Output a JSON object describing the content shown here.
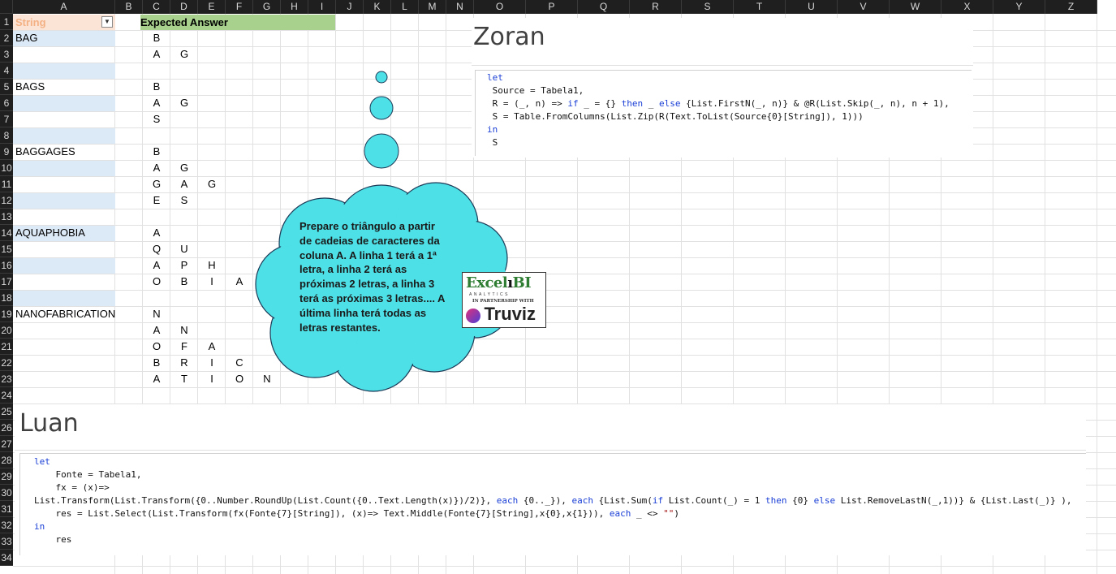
{
  "columns": [
    "A",
    "B",
    "C",
    "D",
    "E",
    "F",
    "G",
    "H",
    "I",
    "J",
    "K",
    "L",
    "M",
    "N",
    "O",
    "P",
    "Q",
    "R",
    "S",
    "T",
    "U",
    "V",
    "W",
    "X",
    "Y",
    "Z"
  ],
  "rows": [
    "1",
    "2",
    "3",
    "4",
    "5",
    "6",
    "7",
    "8",
    "9",
    "10",
    "11",
    "12",
    "13",
    "14",
    "15",
    "16",
    "17",
    "18",
    "19",
    "20",
    "21",
    "22",
    "23",
    "24",
    "25",
    "26",
    "27",
    "28",
    "29",
    "30",
    "31",
    "32",
    "33",
    "34"
  ],
  "table": {
    "header": "String",
    "strings": [
      "BAG",
      "BAGS",
      "BAGGAGES",
      "AQUAPHOBIA",
      "NANOFABRICATION"
    ]
  },
  "expected": {
    "header": "Expected Answer",
    "rows": [
      [
        "B"
      ],
      [
        "A",
        "G"
      ],
      [],
      [
        "B"
      ],
      [
        "A",
        "G"
      ],
      [
        "S"
      ],
      [],
      [
        "B"
      ],
      [
        "A",
        "G"
      ],
      [
        "G",
        "A",
        "G"
      ],
      [
        "E",
        "S"
      ],
      [],
      [
        "A"
      ],
      [
        "Q",
        "U"
      ],
      [
        "A",
        "P",
        "H"
      ],
      [
        "O",
        "B",
        "I",
        "A"
      ],
      [],
      [
        "N"
      ],
      [
        "A",
        "N"
      ],
      [
        "O",
        "F",
        "A"
      ],
      [
        "B",
        "R",
        "I",
        "C"
      ],
      [
        "A",
        "T",
        "I",
        "O",
        "N"
      ]
    ]
  },
  "zoran": {
    "title": "Zoran",
    "code": [
      "let",
      " Source = Tabela1,",
      " R = (_, n) => if _ = {} then _ else {List.FirstN(_, n)} & @R(List.Skip(_, n), n + 1),",
      " S = Table.FromColumns(List.Zip(R(Text.ToList(Source{0}[String]), 1)))",
      "in",
      " S"
    ]
  },
  "luan": {
    "title": "Luan",
    "code": [
      "let",
      "    Fonte = Tabela1,",
      "    fx = (x)=>",
      "List.Transform(List.Transform({0..Number.RoundUp(List.Count({0..Text.Length(x)})/2)}, each {0.._}), each {List.Sum(if List.Count(_) = 1 then {0} else List.RemoveLastN(_,1))} & {List.Last(_)} ),",
      "    res = List.Select(List.Transform(fx(Fonte{7}[String]), (x)=> Text.Middle(Fonte{7}[String],x{0},x{1})), each _ <> \"\")",
      "in",
      "    res"
    ]
  },
  "cloud": {
    "text": "Prepare o triângulo a partir de cadeias de caracteres da coluna A. A linha 1 terá a 1ª letra, a linha 2 terá as próximas 2 letras, a linha 3 terá as próximas 3 letras.... A última linha terá todas as letras restantes."
  },
  "logo": {
    "brand_left": "Excel",
    "brand_right": "BI",
    "sub": "ANALYTICS",
    "partner": "IN PARTNERSHIP WITH",
    "partner_name": "Truviz"
  },
  "colors": {
    "header_bg": "#1f1f1f",
    "table_header_bg": "#fbe3d6",
    "table_band": "#dce9f6",
    "expected_header_bg": "#a9d18e",
    "cloud_fill": "#4de0e6",
    "keyword": "#1a3fd6"
  }
}
